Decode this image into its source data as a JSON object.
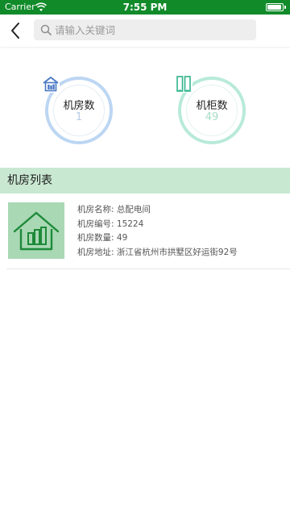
{
  "status_bar": {
    "carrier": "Carrier",
    "time": "7:55 PM",
    "battery_level": 0.95,
    "color": "#118b2a"
  },
  "header": {
    "back_icon": "chevron-left-icon",
    "search": {
      "placeholder": "请输入关键词",
      "value": "",
      "icon": "search-icon"
    }
  },
  "stats": {
    "rooms": {
      "label": "机房数",
      "value": "1",
      "icon": "house-icon",
      "ring_color": "#bcd6f3"
    },
    "cabinets": {
      "label": "机柜数",
      "value": "49",
      "icon": "cabinet-icon",
      "ring_color": "#b8ead8"
    }
  },
  "section": {
    "title": "机房列表",
    "color": "#c9e8d2"
  },
  "rooms": [
    {
      "thumbnail_icon": "house-cabinets-icon",
      "name_label": "机房名称:",
      "name": "总配电间",
      "code_label": "机房编号:",
      "code": "15224",
      "count_label": "机房数量:",
      "count": "49",
      "address_label": "机房地址:",
      "address": "浙江省杭州市拱墅区好运街92号"
    }
  ]
}
